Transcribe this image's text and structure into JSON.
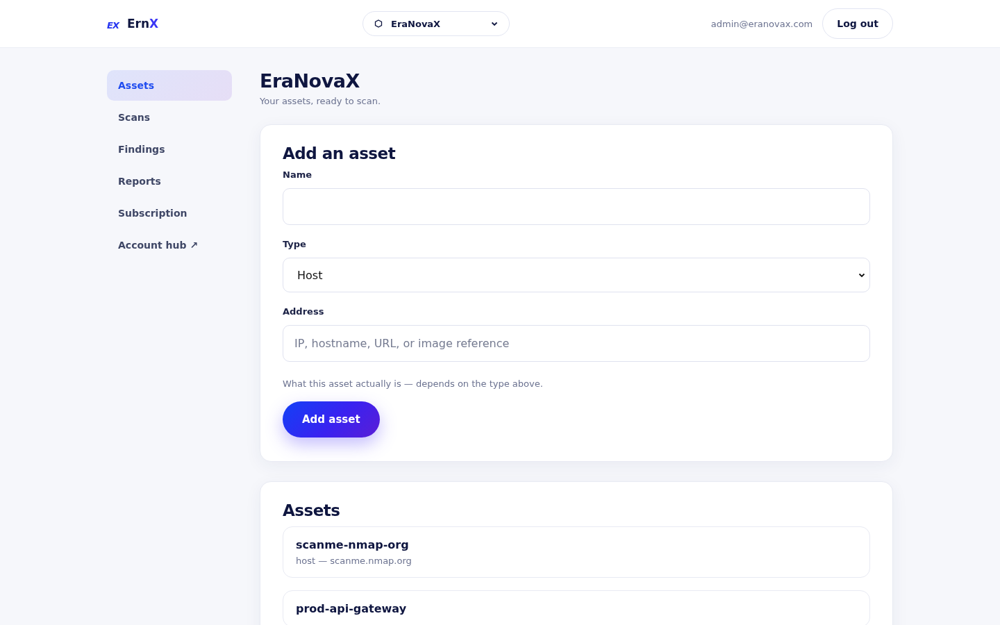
{
  "header": {
    "logo_mark": "EX",
    "brand": "Ern",
    "brand_accent": "X",
    "workspace": "EraNovaX",
    "user_email": "admin@eranovax.com",
    "logout": "Log out"
  },
  "sidebar": {
    "items": [
      {
        "label": "Assets",
        "selected": true
      },
      {
        "label": "Scans",
        "selected": false
      },
      {
        "label": "Findings",
        "selected": false
      },
      {
        "label": "Reports",
        "selected": false
      },
      {
        "label": "Subscription",
        "selected": false
      },
      {
        "label": "Account hub ↗",
        "selected": false
      }
    ]
  },
  "page": {
    "title": "EraNovaX",
    "subtitle": "Your assets, ready to scan."
  },
  "form": {
    "title": "Add an asset",
    "fields": [
      {
        "kind": "text",
        "label": "Name"
      },
      {
        "kind": "select",
        "label": "Type",
        "value": "Host"
      },
      {
        "kind": "text",
        "label": "Address",
        "placeholder": "IP, hostname, URL, or image reference"
      }
    ],
    "hint": "What this asset actually is — depends on the type above.",
    "submit": "Add asset"
  },
  "assets": {
    "title": "Assets",
    "items": [
      {
        "name": "scanme-nmap-org",
        "detail": "host — scanme.nmap.org"
      },
      {
        "name": "prod-api-gateway"
      }
    ]
  }
}
